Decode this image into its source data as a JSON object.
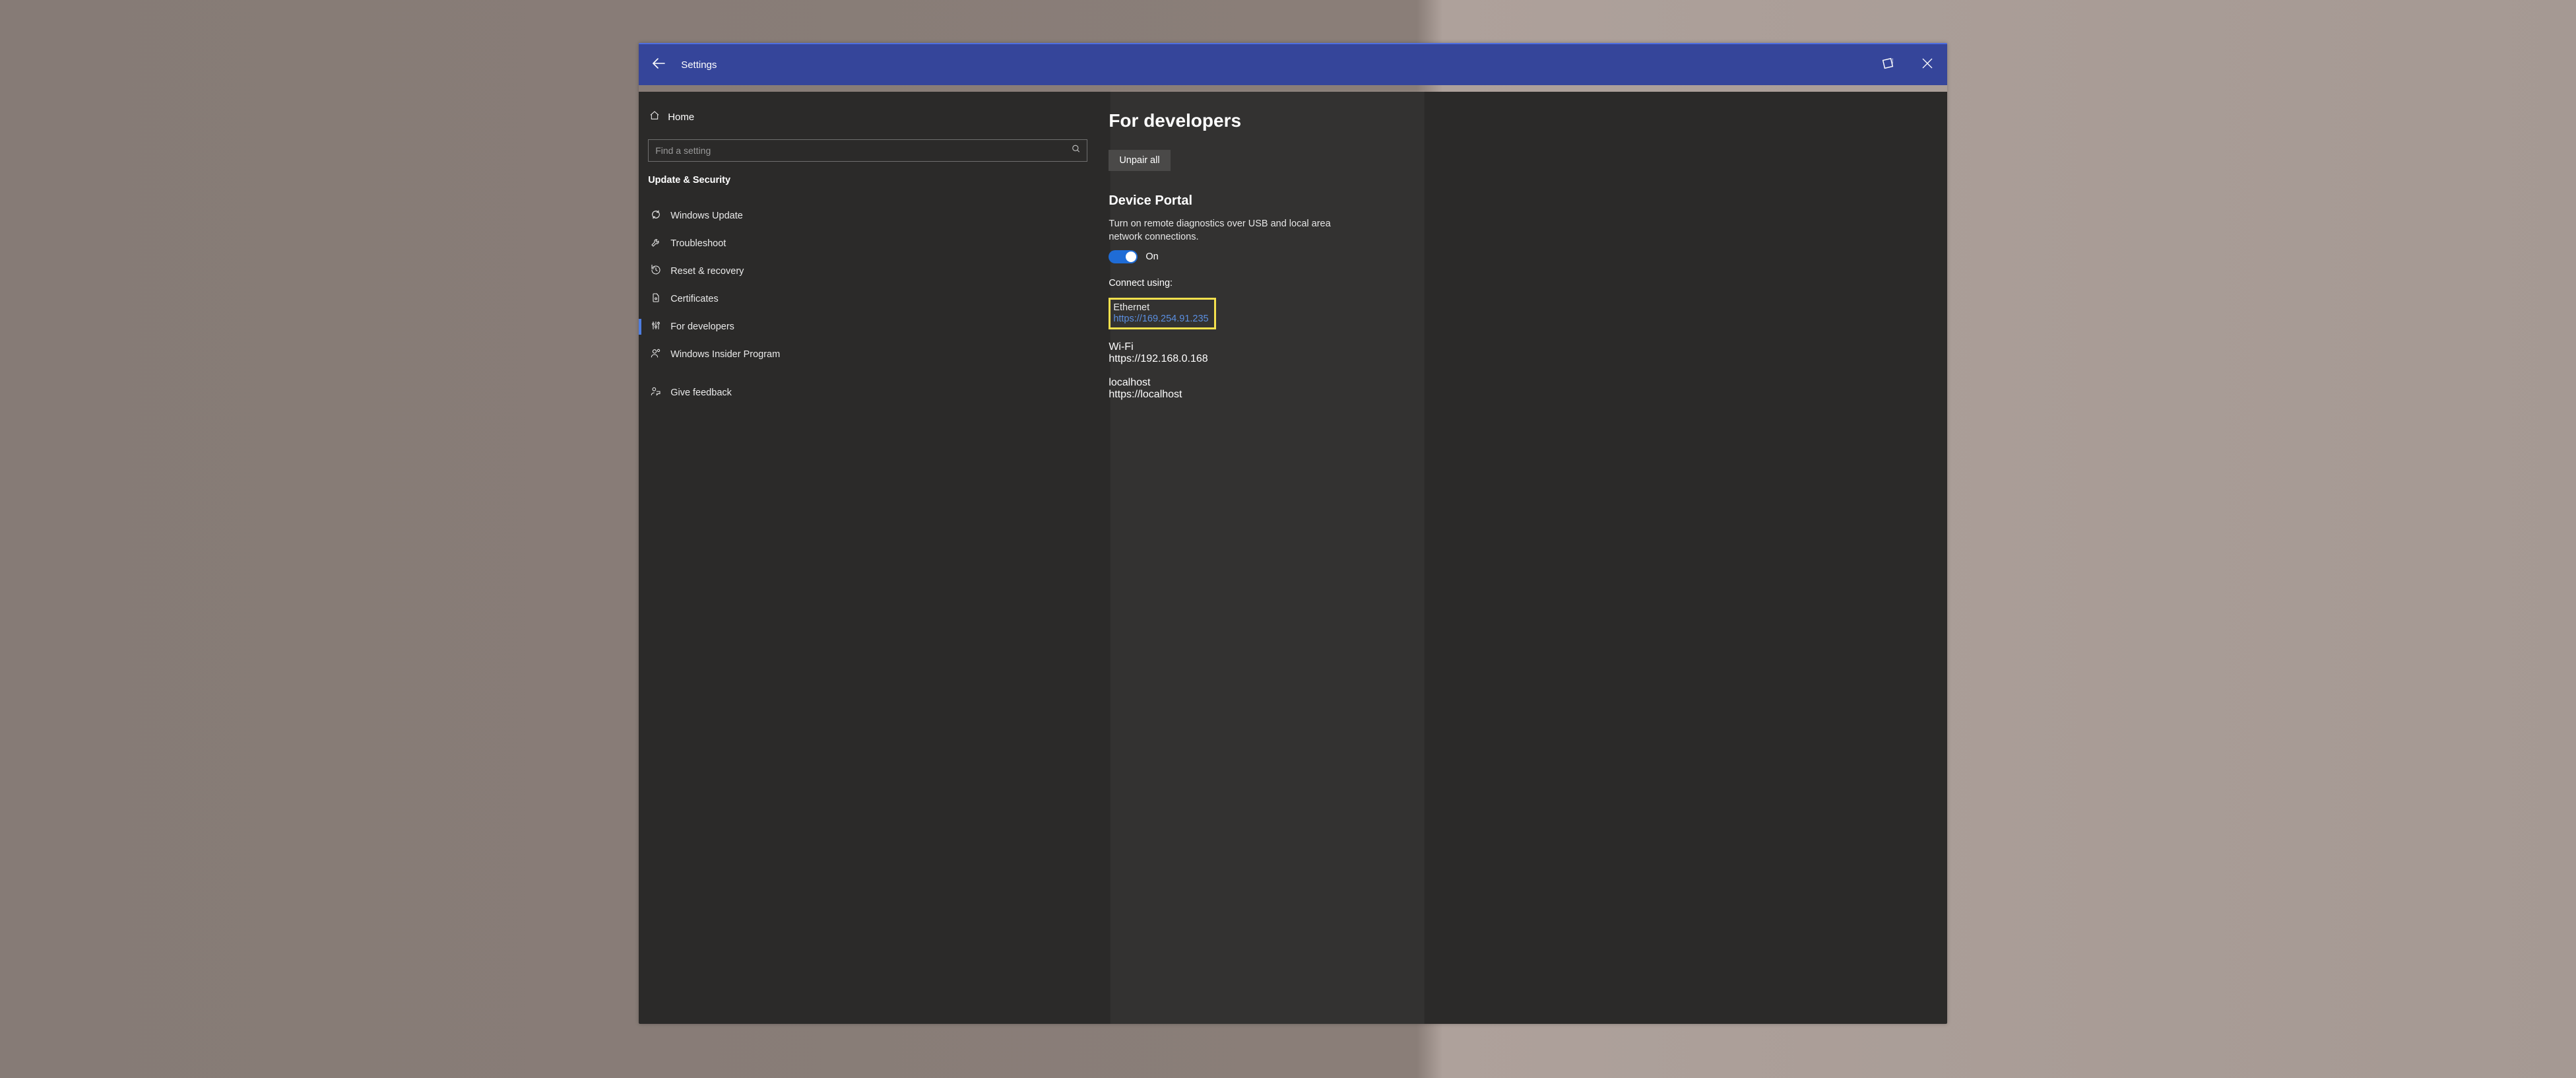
{
  "titlebar": {
    "title": "Settings"
  },
  "sidebar": {
    "home": "Home",
    "search_placeholder": "Find a setting",
    "section": "Update & Security",
    "items": [
      {
        "label": "Windows Update"
      },
      {
        "label": "Troubleshoot"
      },
      {
        "label": "Reset & recovery"
      },
      {
        "label": "Certificates"
      },
      {
        "label": "For developers"
      },
      {
        "label": "Windows Insider Program"
      },
      {
        "label": "Give feedback"
      }
    ]
  },
  "main": {
    "title": "For developers",
    "unpair": "Unpair all",
    "portal": {
      "heading": "Device Portal",
      "description": "Turn on remote diagnostics over USB and local area network connections.",
      "toggle_state": "On",
      "connect_label": "Connect using:",
      "connections": [
        {
          "name": "Ethernet",
          "url": "https://169.254.91.235"
        },
        {
          "name": "Wi-Fi",
          "url": "https://192.168.0.168"
        },
        {
          "name": "localhost",
          "url": "https://localhost"
        }
      ]
    }
  }
}
